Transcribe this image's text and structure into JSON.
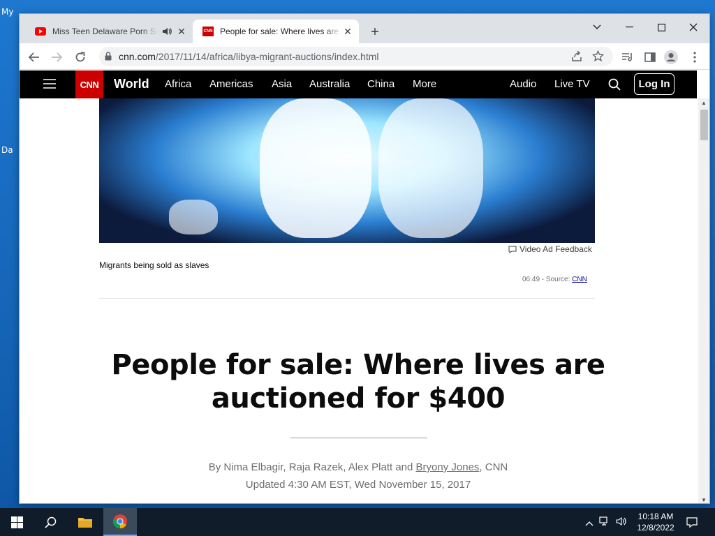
{
  "desktop": {
    "label_top": "My",
    "label_mid": "Da"
  },
  "browser": {
    "tabs": [
      {
        "title": "Miss Teen Delaware Porn Scandal",
        "favicon": "youtube-icon",
        "audio": true
      },
      {
        "title": "People for sale: Where lives are auctioned",
        "favicon": "cnn-icon",
        "favicon_text": "CNN"
      }
    ],
    "url_host": "cnn.com",
    "url_path": "/2017/11/14/africa/libya-migrant-auctions/index.html"
  },
  "cnn": {
    "logo": "CNN",
    "section": "World",
    "nav_items": [
      "Africa",
      "Americas",
      "Asia",
      "Australia",
      "China",
      "More"
    ],
    "audio": "Audio",
    "live_tv": "Live TV",
    "login": "Log In"
  },
  "article": {
    "ad_feedback": "Video Ad Feedback",
    "caption": "Migrants being sold as slaves",
    "duration": "06:49",
    "source_prefix": " - Source: ",
    "source_link": "CNN",
    "headline": "People for sale: Where lives are auctioned for $400",
    "byline_prefix": "By Nima Elbagir, Raja Razek, Alex Platt and ",
    "byline_link": "Bryony Jones",
    "byline_suffix": ", CNN",
    "updated": "Updated 4:30 AM EST, Wed November 15, 2017"
  },
  "taskbar": {
    "time": "10:18 AM",
    "date": "12/8/2022"
  },
  "colors": {
    "cnn_red": "#cc0000",
    "nav_bg": "#000000",
    "taskbar_bg": "#101c2a"
  }
}
